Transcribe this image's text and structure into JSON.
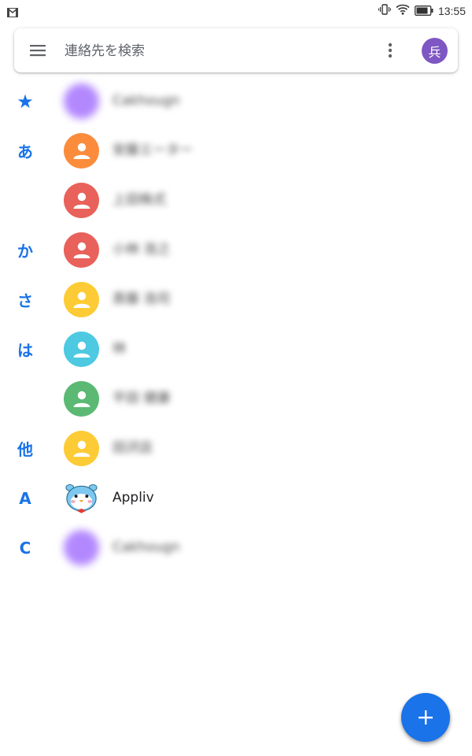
{
  "status_bar": {
    "time": "13:55",
    "icons": [
      "gmail-icon",
      "vibrate-icon",
      "wifi-icon",
      "battery-icon"
    ]
  },
  "search": {
    "placeholder": "連絡先を検索",
    "menu_icon": "menu-icon",
    "more_icon": "more-vert-icon",
    "account_initial": "兵",
    "account_color": "#7e57c2"
  },
  "contacts": [
    {
      "section": "★",
      "name": "Cakhougn",
      "avatar_color": "#b388ff",
      "avatar_type": "photo"
    },
    {
      "section": "あ",
      "name": "安藤エーター",
      "avatar_color": "#fb8c3c",
      "avatar_type": "person"
    },
    {
      "section": "",
      "name": "上田株式",
      "avatar_color": "#e8615a",
      "avatar_type": "person"
    },
    {
      "section": "か",
      "name": "小林 浩之",
      "avatar_color": "#e8615a",
      "avatar_type": "person"
    },
    {
      "section": "さ",
      "name": "斎藤 浩司",
      "avatar_color": "#fdcb35",
      "avatar_type": "person"
    },
    {
      "section": "は",
      "name": "林",
      "avatar_color": "#4dc9e2",
      "avatar_type": "person"
    },
    {
      "section": "",
      "name": "平田 健康",
      "avatar_color": "#5bb974",
      "avatar_type": "person"
    },
    {
      "section": "他",
      "name": "田沢店",
      "avatar_color": "#fdcb35",
      "avatar_type": "person"
    },
    {
      "section": "A",
      "name": "Appliv",
      "avatar_color": "#7ec8ef",
      "avatar_type": "mascot"
    },
    {
      "section": "C",
      "name": "Cakhougn",
      "avatar_color": "#b388ff",
      "avatar_type": "photo"
    }
  ],
  "fab_icon": "add-icon",
  "colors": {
    "accent": "#1a73e8",
    "section_letter": "#1a73e8"
  }
}
